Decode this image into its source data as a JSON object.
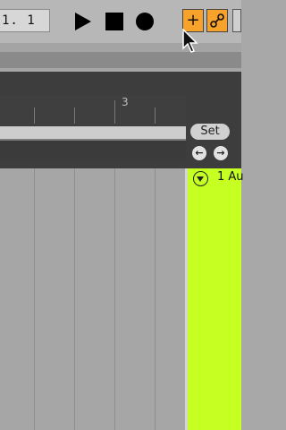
{
  "transport": {
    "position": "1. 1"
  },
  "ruler": {
    "bar_label": "3"
  },
  "locator": {
    "set_label": "Set"
  },
  "track": {
    "name": "1 Au",
    "color": "#c6ff22"
  },
  "colors": {
    "accent_orange": "#f7a22a",
    "track_green": "#c6ff22",
    "panel_dark": "#3d3d3d"
  }
}
